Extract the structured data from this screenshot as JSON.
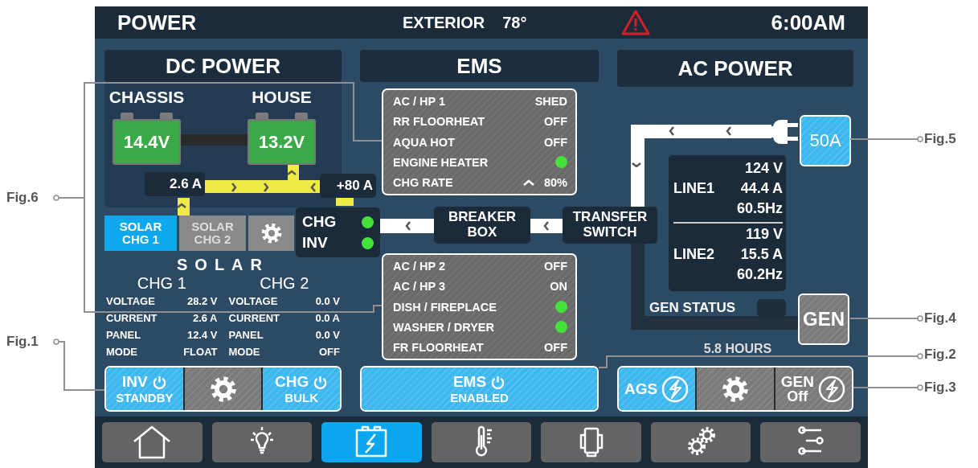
{
  "header": {
    "title": "POWER",
    "exterior_label": "EXTERIOR",
    "exterior_temp": "78°",
    "alert": true,
    "time": "6:00AM"
  },
  "dc_power": {
    "title": "DC POWER",
    "batteries": [
      {
        "name": "CHASSIS",
        "voltage": "14.4V"
      },
      {
        "name": "HOUSE",
        "voltage": "13.2V"
      }
    ],
    "solar_current": "2.6 A",
    "inverter_current": "+80 A",
    "tabs": [
      {
        "label": "SOLAR CHG 1",
        "selected": true
      },
      {
        "label": "SOLAR CHG 2",
        "selected": false
      }
    ],
    "solar": {
      "title": "SOLAR",
      "chargers": [
        {
          "name": "CHG 1",
          "rows": [
            {
              "label": "VOLTAGE",
              "value": "28.2 V"
            },
            {
              "label": "CURRENT",
              "value": "2.6 A"
            },
            {
              "label": "PANEL",
              "value": "12.4 V"
            },
            {
              "label": "MODE",
              "value": "FLOAT"
            }
          ]
        },
        {
          "name": "CHG 2",
          "rows": [
            {
              "label": "VOLTAGE",
              "value": "0.0 V"
            },
            {
              "label": "CURRENT",
              "value": "0.0 A"
            },
            {
              "label": "PANEL",
              "value": "0.0 V"
            },
            {
              "label": "MODE",
              "value": "OFF"
            }
          ]
        }
      ]
    },
    "controls": [
      {
        "kind": "power",
        "label": "INV",
        "status": "STANDBY",
        "active": true
      },
      {
        "kind": "settings",
        "active": false
      },
      {
        "kind": "power",
        "label": "CHG",
        "status": "BULK",
        "active": true
      }
    ]
  },
  "inverter_indicators": [
    {
      "label": "CHG",
      "on": true
    },
    {
      "label": "INV",
      "on": true
    }
  ],
  "ems": {
    "title": "EMS",
    "upper_loads": [
      {
        "kind": "text",
        "name": "AC / HP 1",
        "value": "SHED"
      },
      {
        "kind": "text",
        "name": "RR FLOORHEAT",
        "value": "OFF"
      },
      {
        "kind": "text",
        "name": "AQUA HOT",
        "value": "OFF"
      },
      {
        "kind": "dot",
        "name": "ENGINE HEATER",
        "on": true
      },
      {
        "kind": "rate",
        "name": "CHG RATE",
        "value": "80%"
      }
    ],
    "breaker_box": "BREAKER BOX",
    "transfer_switch": "TRANSFER SWITCH",
    "lower_loads": [
      {
        "kind": "text",
        "name": "AC / HP 2",
        "value": "OFF"
      },
      {
        "kind": "text",
        "name": "AC / HP 3",
        "value": "ON"
      },
      {
        "kind": "dot",
        "name": "DISH / FIREPLACE",
        "on": true
      },
      {
        "kind": "dot",
        "name": "WASHER / DRYER",
        "on": true
      },
      {
        "kind": "text",
        "name": "FR FLOORHEAT",
        "value": "OFF"
      }
    ],
    "button": {
      "label": "EMS",
      "status": "ENABLED",
      "active": true
    }
  },
  "ac_power": {
    "title": "AC POWER",
    "shore": {
      "label": "50A",
      "active": true
    },
    "lines": [
      {
        "name": "LINE1",
        "voltage": "124 V",
        "current": "44.4 A",
        "frequency": "60.5Hz"
      },
      {
        "name": "LINE2",
        "voltage": "119 V",
        "current": "15.5 A",
        "frequency": "60.2Hz"
      }
    ],
    "gen_status": {
      "label": "GEN STATUS",
      "on": false
    },
    "generator": {
      "label": "GEN",
      "active": false
    },
    "runtime": "5.8 HOURS",
    "controls": [
      {
        "kind": "ags",
        "label": "AGS",
        "active": true
      },
      {
        "kind": "settings",
        "active": false
      },
      {
        "kind": "gen",
        "label": "GEN",
        "status": "Off",
        "active": false
      }
    ]
  },
  "nav": [
    {
      "kind": "home",
      "selected": false
    },
    {
      "kind": "bulb",
      "selected": false
    },
    {
      "kind": "battery",
      "selected": true
    },
    {
      "kind": "thermometer",
      "selected": false
    },
    {
      "kind": "generator",
      "selected": false
    },
    {
      "kind": "gears",
      "selected": false
    },
    {
      "kind": "sliders",
      "selected": false
    }
  ],
  "callouts": [
    {
      "label": "Fig.6"
    },
    {
      "label": "Fig.1"
    },
    {
      "label": "Fig.5"
    },
    {
      "label": "Fig.4"
    },
    {
      "label": "Fig.2"
    },
    {
      "label": "Fig.3"
    }
  ]
}
